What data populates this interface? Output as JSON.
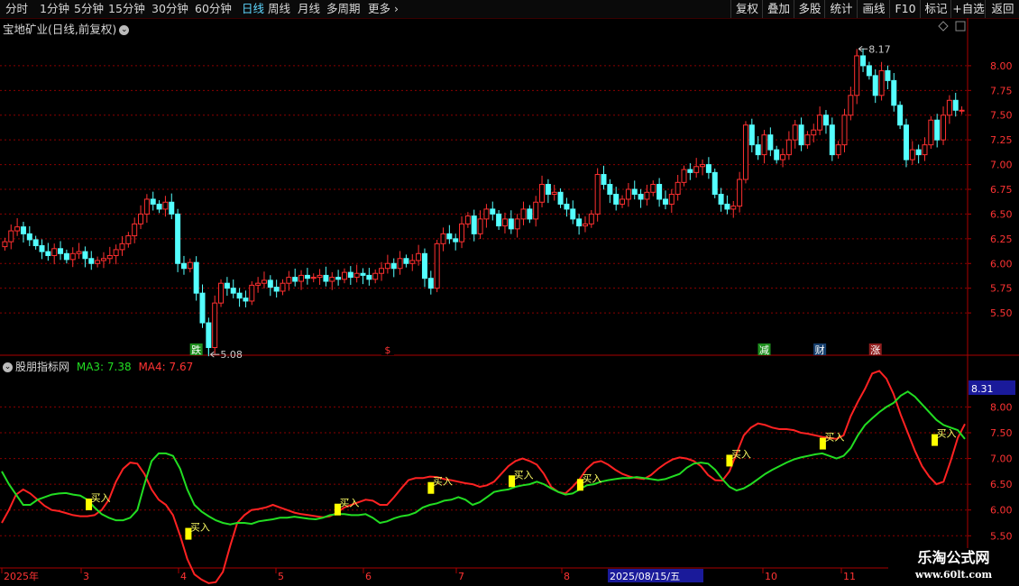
{
  "toolbar": {
    "timeframes": [
      "分时",
      "1分钟",
      "5分钟",
      "15分钟",
      "30分钟",
      "60分钟",
      "日线",
      "周线",
      "月线",
      "多周期",
      "更多"
    ],
    "active_index": 6,
    "more_arrow": "›",
    "right_buttons": [
      "复权",
      "叠加",
      "多股",
      "统计",
      "画线",
      "F10",
      "标记",
      "+自选",
      "返回"
    ]
  },
  "main": {
    "title": "宝地矿业(日线,前复权)",
    "chevron_icon": "chevron-down-icon",
    "high_label": "8.17",
    "low_label": "5.08",
    "markers": [
      "跌",
      "$",
      "减",
      "财",
      "涨"
    ]
  },
  "sub": {
    "title": "股朋指标网",
    "ma3_label": "MA3: 7.38",
    "ma4_label": "MA4: 7.67",
    "current_value": "8.31",
    "buy_label": "买入"
  },
  "xaxis": {
    "labels": [
      "2025年",
      "3",
      "4",
      "5",
      "6",
      "7",
      "8",
      "2025/08/15/五",
      "10",
      "11"
    ]
  },
  "watermark": {
    "line1": "乐淘公式网",
    "line2": "www.60lt.com"
  },
  "colors": {
    "up": "#ff3030",
    "down": "#54ffff",
    "ma3": "#22dd22",
    "ma4": "#ff2222",
    "buy": "#ffff00",
    "axis": "#aa0000"
  },
  "chart_data": [
    {
      "type": "candlestick",
      "title": "宝地矿业(日线,前复权)",
      "ylim": [
        5.2,
        8.3
      ],
      "yticks": [
        5.5,
        5.75,
        6.0,
        6.25,
        6.5,
        6.75,
        7.0,
        7.25,
        7.5,
        7.75,
        8.0
      ],
      "annotations": [
        {
          "text": "8.17",
          "value": 8.17
        },
        {
          "text": "5.08",
          "value": 5.08
        }
      ],
      "close": [
        6.22,
        6.33,
        6.37,
        6.3,
        6.24,
        6.18,
        6.12,
        6.08,
        6.15,
        6.1,
        6.04,
        6.1,
        6.12,
        6.05,
        6.0,
        6.03,
        6.05,
        6.08,
        6.14,
        6.2,
        6.28,
        6.4,
        6.5,
        6.65,
        6.6,
        6.55,
        6.62,
        6.5,
        6.0,
        5.95,
        6.01,
        5.7,
        5.4,
        5.15,
        5.6,
        5.8,
        5.75,
        5.7,
        5.65,
        5.62,
        5.78,
        5.8,
        5.83,
        5.76,
        5.72,
        5.8,
        5.86,
        5.82,
        5.88,
        5.85,
        5.86,
        5.88,
        5.82,
        5.86,
        5.84,
        5.91,
        5.86,
        5.9,
        5.88,
        5.84,
        5.9,
        5.95,
        6.0,
        5.95,
        6.05,
        6.0,
        6.03,
        6.1,
        5.85,
        5.75,
        6.2,
        6.3,
        6.25,
        6.22,
        6.4,
        6.48,
        6.3,
        6.45,
        6.55,
        6.5,
        6.38,
        6.45,
        6.35,
        6.45,
        6.55,
        6.45,
        6.62,
        6.8,
        6.7,
        6.72,
        6.6,
        6.55,
        6.45,
        6.38,
        6.4,
        6.5,
        6.9,
        6.8,
        6.7,
        6.6,
        6.65,
        6.75,
        6.7,
        6.65,
        6.72,
        6.8,
        6.65,
        6.6,
        6.7,
        6.82,
        6.95,
        6.92,
        6.98,
        7.0,
        6.92,
        6.7,
        6.6,
        6.55,
        6.58,
        6.85,
        7.4,
        7.2,
        7.1,
        7.3,
        7.15,
        7.05,
        7.1,
        7.25,
        7.4,
        7.2,
        7.3,
        7.35,
        7.5,
        7.4,
        7.1,
        7.2,
        7.5,
        7.7,
        8.1,
        8.0,
        7.9,
        7.7,
        7.95,
        7.85,
        7.6,
        7.4,
        7.05,
        7.15,
        7.1,
        7.2,
        7.45,
        7.25,
        7.5,
        7.65,
        7.55,
        7.55
      ]
    },
    {
      "type": "line",
      "title": "股朋指标网",
      "ylim": [
        5.4,
        8.55
      ],
      "yticks": [
        5.5,
        6.0,
        6.5,
        7.0,
        7.5,
        8.0
      ],
      "series": [
        {
          "name": "MA3",
          "values": [
            6.75,
            6.5,
            6.3,
            6.1,
            6.1,
            6.2,
            6.25,
            6.3,
            6.32,
            6.33,
            6.3,
            6.28,
            6.2,
            6.05,
            5.92,
            5.85,
            5.8,
            5.8,
            5.85,
            6.0,
            6.5,
            6.95,
            7.1,
            7.1,
            7.05,
            6.8,
            6.4,
            6.1,
            5.97,
            5.88,
            5.8,
            5.75,
            5.72,
            5.75,
            5.75,
            5.73,
            5.78,
            5.8,
            5.82,
            5.85,
            5.85,
            5.87,
            5.85,
            5.83,
            5.82,
            5.85,
            5.9,
            5.92,
            5.92,
            5.9,
            5.9,
            5.92,
            5.85,
            5.75,
            5.78,
            5.84,
            5.88,
            5.9,
            5.95,
            6.05,
            6.1,
            6.13,
            6.18,
            6.2,
            6.25,
            6.2,
            6.1,
            6.15,
            6.25,
            6.35,
            6.38,
            6.4,
            6.45,
            6.48,
            6.5,
            6.55,
            6.5,
            6.42,
            6.35,
            6.3,
            6.32,
            6.4,
            6.48,
            6.5,
            6.55,
            6.58,
            6.6,
            6.62,
            6.62,
            6.64,
            6.62,
            6.6,
            6.58,
            6.6,
            6.65,
            6.7,
            6.82,
            6.9,
            6.92,
            6.9,
            6.78,
            6.6,
            6.45,
            6.38,
            6.42,
            6.5,
            6.6,
            6.7,
            6.78,
            6.85,
            6.92,
            6.98,
            7.02,
            7.05,
            7.08,
            7.1,
            7.05,
            7.0,
            7.05,
            7.2,
            7.45,
            7.65,
            7.78,
            7.9,
            8.0,
            8.08,
            8.22,
            8.3,
            8.2,
            8.05,
            7.9,
            7.75,
            7.65,
            7.6,
            7.55,
            7.38
          ]
        },
        {
          "name": "MA4",
          "values": [
            5.75,
            6.0,
            6.3,
            6.4,
            6.32,
            6.2,
            6.08,
            6.0,
            5.98,
            5.94,
            5.9,
            5.88,
            5.88,
            5.9,
            6.0,
            6.2,
            6.55,
            6.8,
            6.92,
            6.9,
            6.7,
            6.4,
            6.2,
            6.1,
            5.9,
            5.5,
            5.05,
            4.75,
            4.65,
            4.58,
            4.6,
            4.8,
            5.3,
            5.75,
            5.9,
            6.0,
            6.02,
            6.05,
            6.1,
            6.05,
            6.0,
            5.95,
            5.92,
            5.9,
            5.88,
            5.86,
            5.88,
            5.95,
            6.05,
            6.1,
            6.15,
            6.2,
            6.18,
            6.1,
            6.1,
            6.25,
            6.42,
            6.58,
            6.62,
            6.62,
            6.65,
            6.64,
            6.6,
            6.58,
            6.55,
            6.52,
            6.5,
            6.45,
            6.48,
            6.55,
            6.7,
            6.85,
            6.95,
            7.0,
            6.95,
            6.88,
            6.7,
            6.45,
            6.35,
            6.32,
            6.45,
            6.6,
            6.8,
            6.92,
            6.95,
            6.88,
            6.78,
            6.7,
            6.65,
            6.62,
            6.6,
            6.68,
            6.8,
            6.9,
            6.98,
            7.02,
            7.0,
            6.95,
            6.85,
            6.68,
            6.58,
            6.57,
            6.75,
            7.1,
            7.45,
            7.6,
            7.68,
            7.65,
            7.6,
            7.57,
            7.57,
            7.55,
            7.5,
            7.48,
            7.45,
            7.42,
            7.4,
            7.38,
            7.45,
            7.82,
            8.1,
            8.35,
            8.65,
            8.7,
            8.55,
            8.25,
            7.85,
            7.5,
            7.15,
            6.85,
            6.65,
            6.5,
            6.55,
            6.95,
            7.4,
            7.67
          ]
        }
      ],
      "buy_signals": [
        {
          "index": 14,
          "value": 6.1
        },
        {
          "index": 30,
          "value": 5.53
        },
        {
          "index": 54,
          "value": 6.0
        },
        {
          "index": 69,
          "value": 6.42
        },
        {
          "index": 82,
          "value": 6.55
        },
        {
          "index": 93,
          "value": 6.48
        },
        {
          "index": 117,
          "value": 6.95
        },
        {
          "index": 132,
          "value": 7.28
        },
        {
          "index": 150,
          "value": 7.35
        }
      ]
    }
  ]
}
